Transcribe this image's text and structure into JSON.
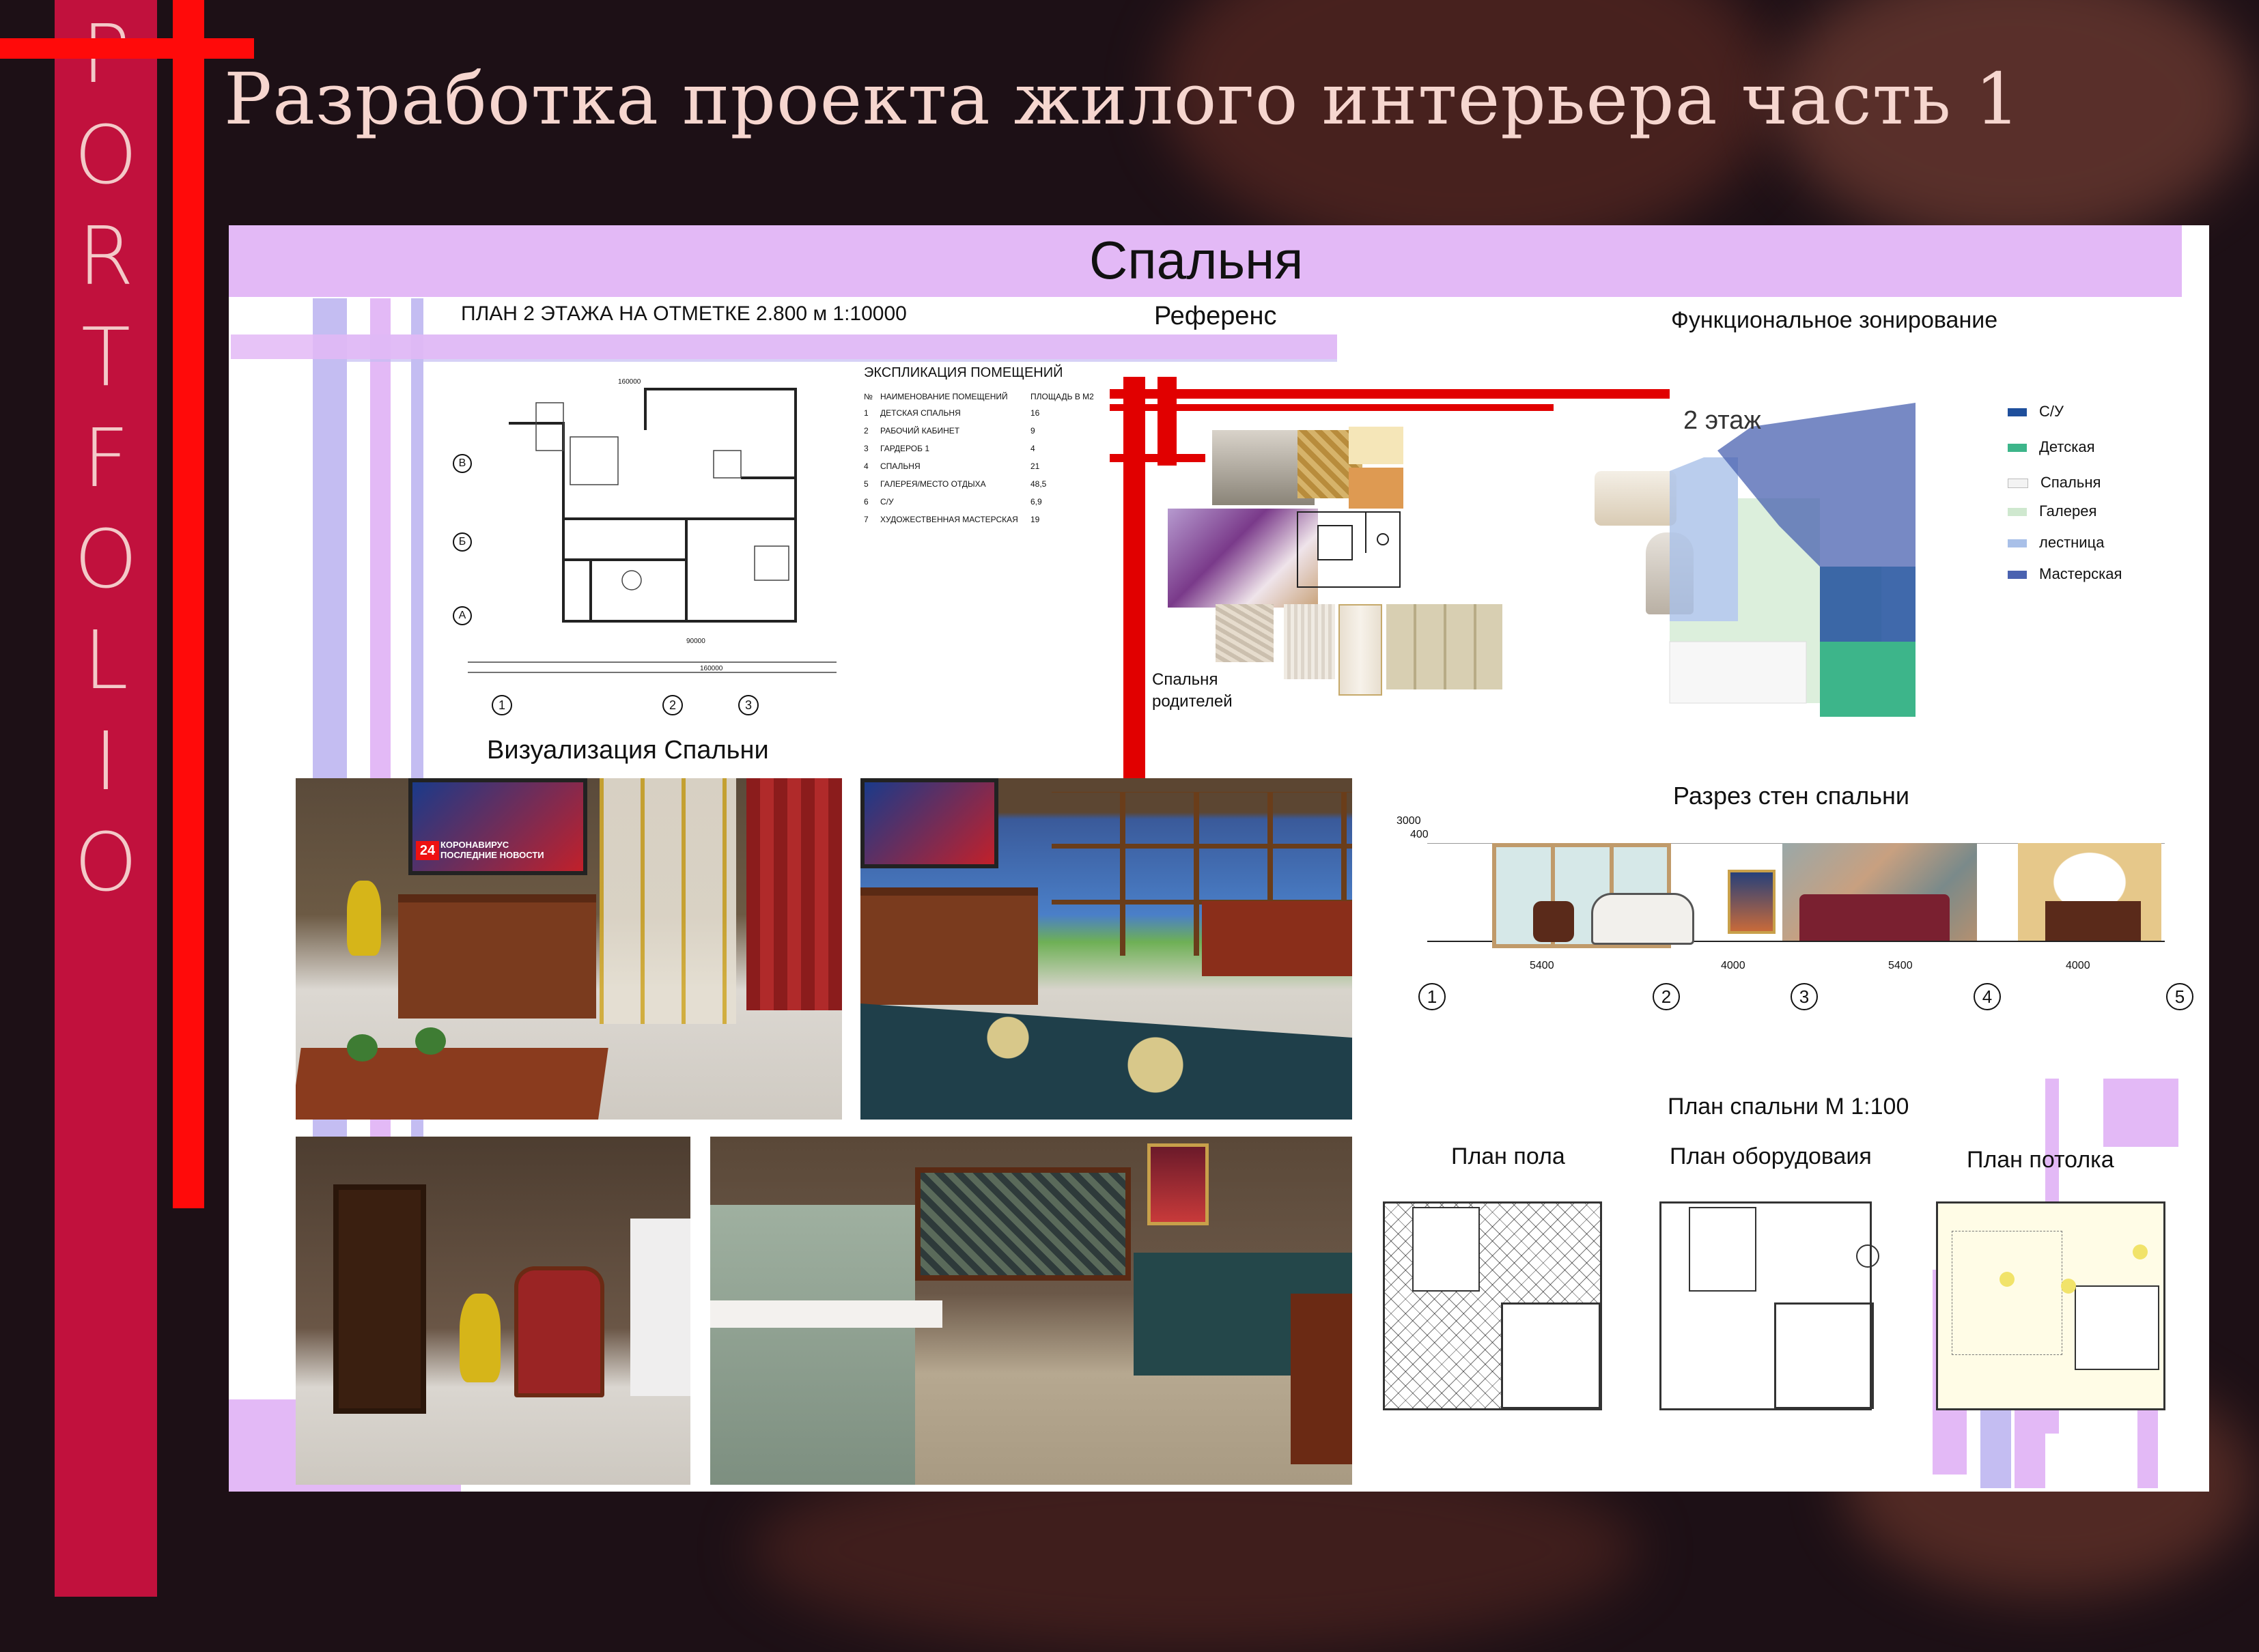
{
  "header": {
    "sidebar_letters": [
      "P",
      "O",
      "R",
      "T",
      "F",
      "O",
      "L",
      "I",
      "O"
    ],
    "title": "Разработка проекта жилого интерьера часть 1"
  },
  "board": {
    "room_title": "Спальня",
    "plan_title": "ПЛАН 2 ЭТАЖА НА ОТМЕТКЕ 2.800 м 1:10000",
    "reference_title": "Референс",
    "zoning_title": "Функциональное зонирование",
    "zoning_floor_label": "2 этаж",
    "reference_caption_line1": "Спальня",
    "reference_caption_line2": "родителей",
    "explication": {
      "title": "ЭКСПЛИКАЦИЯ ПОМЕЩЕНИЙ",
      "col_no": "№",
      "col_name": "НАИМЕНОВАНИЕ ПОМЕЩЕНИЙ",
      "col_area": "ПЛОЩАДЬ В М2",
      "rows": [
        {
          "no": "1",
          "name": "ДЕТСКАЯ СПАЛЬНЯ",
          "area": "16"
        },
        {
          "no": "2",
          "name": "РАБОЧИЙ КАБИНЕТ",
          "area": "9"
        },
        {
          "no": "3",
          "name": "ГАРДЕРОБ 1",
          "area": "4"
        },
        {
          "no": "4",
          "name": "СПАЛЬНЯ",
          "area": "21"
        },
        {
          "no": "5",
          "name": "ГАЛЕРЕЯ/МЕСТО ОТДЫХА",
          "area": "48,5"
        },
        {
          "no": "6",
          "name": "С/У",
          "area": "6,9"
        },
        {
          "no": "7",
          "name": "ХУДОЖЕСТВЕННАЯ МАСТЕРСКАЯ",
          "area": "19"
        }
      ]
    },
    "legend": [
      {
        "label": "С/У",
        "color": "#1f4f9c"
      },
      {
        "label": "Детская",
        "color": "#3db58a"
      },
      {
        "label": "Спальня",
        "color": "#f3f3f3"
      },
      {
        "label": "Галерея",
        "color": "#cfe8cf"
      },
      {
        "label": "лестница",
        "color": "#a9c0e8"
      },
      {
        "label": "Мастерская",
        "color": "#4a62b0"
      }
    ],
    "visualization_title": "Визуализация Спальни",
    "tv_badge": "24",
    "tv_line1": "КОРОНАВИРУС",
    "tv_line2": "ПОСЛЕДНИЕ НОВОСТИ",
    "section_title": "Разрез стен спальни",
    "section_dims": [
      "5400",
      "4000",
      "5400",
      "4000"
    ],
    "section_axes": [
      "1",
      "2",
      "3",
      "4",
      "5"
    ],
    "section_heights": [
      "3000",
      "400"
    ],
    "plan_axes_x": [
      "1",
      "2",
      "3"
    ],
    "plan_axes_y": [
      "В",
      "Б",
      "А"
    ],
    "bedroom_plan_title": "План спальни М 1:100",
    "floor_plan_title": "План пола",
    "equipment_plan_title": "План оборудоваия",
    "ceiling_plan_title": "План потолка"
  },
  "colors": {
    "sidebar": "#c1113d",
    "accent_red": "#ff0a0a",
    "lilac": "#e3b9f6",
    "periwinkle": "#c4bdf2",
    "title_text": "#f6d6cf"
  }
}
